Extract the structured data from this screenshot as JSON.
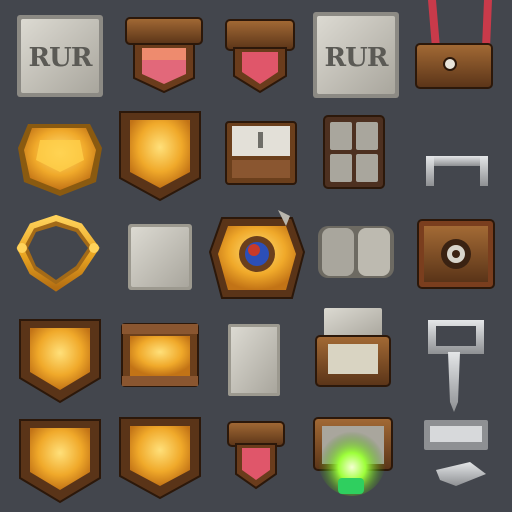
{
  "sheet": {
    "background": "#43464d",
    "colors": {
      "wood_dark": "#3a2212",
      "wood": "#7a4a22",
      "wood_light": "#a36a35",
      "gold_dark": "#8a5a10",
      "gold": "#e8a320",
      "gold_light": "#ffd25a",
      "stone_dark": "#6f6e68",
      "stone": "#b9b6ad",
      "stone_light": "#dcdad2",
      "steel": "#c9cbcd",
      "steel_dark": "#6e7073",
      "red": "#d24a5a",
      "green_glow": "#7dff3a",
      "gem_blue": "#2c4fb8",
      "gem_red": "#c83a2a"
    }
  },
  "tiles": {
    "r1c1_text": "RUR",
    "r1c4_text": "RUR"
  },
  "icons": [
    {
      "row": 1,
      "col": 1,
      "name": "stone-label-tile-icon"
    },
    {
      "row": 1,
      "col": 2,
      "name": "wooden-banner-red-icon"
    },
    {
      "row": 1,
      "col": 3,
      "name": "wooden-banner-red-small-icon"
    },
    {
      "row": 1,
      "col": 4,
      "name": "stone-label-tile-icon"
    },
    {
      "row": 1,
      "col": 5,
      "name": "wooden-sign-red-strap-icon"
    },
    {
      "row": 2,
      "col": 1,
      "name": "gold-shield-badge-icon"
    },
    {
      "row": 2,
      "col": 2,
      "name": "wooden-gold-shield-icon"
    },
    {
      "row": 2,
      "col": 3,
      "name": "wooden-frame-stone-panel-icon"
    },
    {
      "row": 2,
      "col": 4,
      "name": "stone-grid-window-icon"
    },
    {
      "row": 2,
      "col": 5,
      "name": "steel-bracket-icon"
    },
    {
      "row": 3,
      "col": 1,
      "name": "gold-ornate-ring-frame-icon"
    },
    {
      "row": 3,
      "col": 2,
      "name": "stone-square-tile-icon"
    },
    {
      "row": 3,
      "col": 3,
      "name": "wooden-gem-emblem-icon"
    },
    {
      "row": 3,
      "col": 4,
      "name": "stone-scroll-panel-icon"
    },
    {
      "row": 3,
      "col": 5,
      "name": "wooden-ring-sign-icon"
    },
    {
      "row": 4,
      "col": 1,
      "name": "gold-shield-icon"
    },
    {
      "row": 4,
      "col": 2,
      "name": "gold-chest-panel-icon"
    },
    {
      "row": 4,
      "col": 3,
      "name": "stone-slab-icon"
    },
    {
      "row": 4,
      "col": 4,
      "name": "stone-wood-crate-icon"
    },
    {
      "row": 4,
      "col": 5,
      "name": "steel-post-icon"
    },
    {
      "row": 5,
      "col": 1,
      "name": "gold-shield-icon"
    },
    {
      "row": 5,
      "col": 2,
      "name": "wooden-gold-shield-icon"
    },
    {
      "row": 5,
      "col": 3,
      "name": "wooden-banner-red-small-icon"
    },
    {
      "row": 5,
      "col": 4,
      "name": "green-glow-chest-icon"
    },
    {
      "row": 5,
      "col": 5,
      "name": "steel-plates-icon"
    }
  ]
}
